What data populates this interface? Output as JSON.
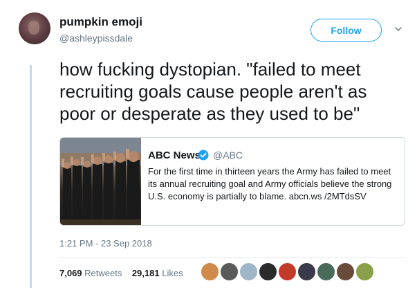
{
  "tweet": {
    "display_name": "pumpkin emoji",
    "handle": "@ashleypissdale",
    "follow_label": "Follow",
    "text": "how fucking dystopian. \"failed to meet recruiting goals cause people aren't as poor or desperate as they used to be\"",
    "timestamp": "1:21 PM - 23 Sep 2018",
    "retweets_count": "7,069",
    "retweets_label": "Retweets",
    "likes_count": "29,181",
    "likes_label": "Likes"
  },
  "quoted_tweet": {
    "name": "ABC News",
    "handle": "@ABC",
    "text": "For the first time in thirteen years the Army has failed to meet its annual recruiting goal and Army officials believe the strong U.S. economy is partially to blame. abcn.ws /2MTdsSV"
  },
  "colors": {
    "accent": "#1da1f2",
    "secondary_text": "#657786",
    "primary_text": "#14171a",
    "border": "#ccd6dd"
  },
  "likers": [
    {
      "color": "#d08a4a"
    },
    {
      "color": "#5a5a5a"
    },
    {
      "color": "#9fb6c9"
    },
    {
      "color": "#2b2b2b"
    },
    {
      "color": "#c23a2a"
    },
    {
      "color": "#3a3a4a"
    },
    {
      "color": "#4a6a5a"
    },
    {
      "color": "#6a4a3a"
    },
    {
      "color": "#8aa04a"
    }
  ]
}
